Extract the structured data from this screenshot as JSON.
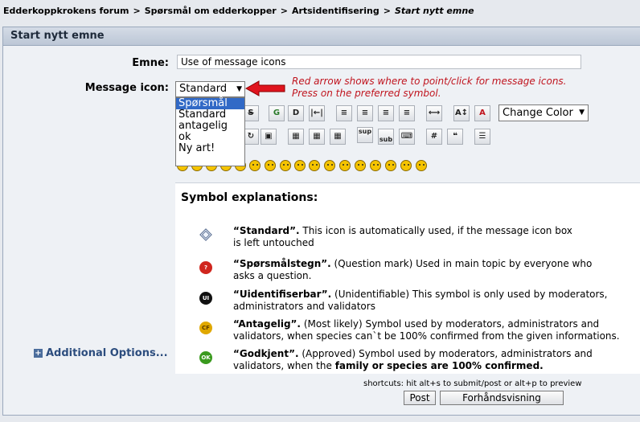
{
  "breadcrumb": {
    "items": [
      "Edderkoppkrokens forum",
      "Spørsmål om edderkopper",
      "Artsidentifisering"
    ],
    "current": "Start nytt emne",
    "separator": ">"
  },
  "panel": {
    "title": "Start nytt emne"
  },
  "form": {
    "subject_label": "Emne:",
    "subject_value": "Use of message icons",
    "icon_label": "Message icon:",
    "icon_selected": "Standard",
    "icon_options": [
      "Spørsmål",
      "Standard",
      "antagelig",
      "ok",
      "Ny art!"
    ],
    "hint_line1": "Red arrow shows where to point/click for message icons.",
    "hint_line2": "Press on the preferred symbol."
  },
  "toolbar": {
    "color_select": "Change Color",
    "labels": {
      "superscript": "sup",
      "subscript": "sub",
      "hash": "#"
    }
  },
  "explanations": {
    "title": "Symbol explanations:",
    "items": [
      {
        "name": "“Standard”.",
        "line1": " This icon is automatically used, if the message icon box",
        "line2": " is left untouched",
        "icon": "standard-icon"
      },
      {
        "name": "“Spørsmålstegn”.",
        "line1": " (Question mark) Used in main topic by everyone who",
        "line2": "asks a question.",
        "icon": "question-icon",
        "badge": "?",
        "color": "#d0261e"
      },
      {
        "name": "“Uidentifiserbar”.",
        "line1": " (Unidentifiable) This symbol is only used by moderators,",
        "line2": "administrators and validators",
        "icon": "unidentifiable-icon",
        "badge": "UI",
        "color": "#111111"
      },
      {
        "name": "“Antagelig”.",
        "line1": " (Most likely) Symbol used by moderators, administrators and",
        "line2": "validators, when species can`t be 100% confirmed from the given informations.",
        "icon": "most-likely-icon",
        "badge": "CF",
        "color": "#e0a800"
      },
      {
        "name": "“Godkjent”.",
        "line1": " (Approved) Symbol used by moderators, administrators and",
        "line2a": "validators, when the ",
        "line2b": "family or species are 100% confirmed.",
        "icon": "approved-icon",
        "badge": "OK",
        "color": "#3a9a1e"
      }
    ]
  },
  "additional_options": "Additional Options...",
  "shortcuts": "shortcuts: hit alt+s to submit/post or alt+p to preview",
  "buttons": {
    "post": "Post",
    "preview": "Forhåndsvisning"
  }
}
